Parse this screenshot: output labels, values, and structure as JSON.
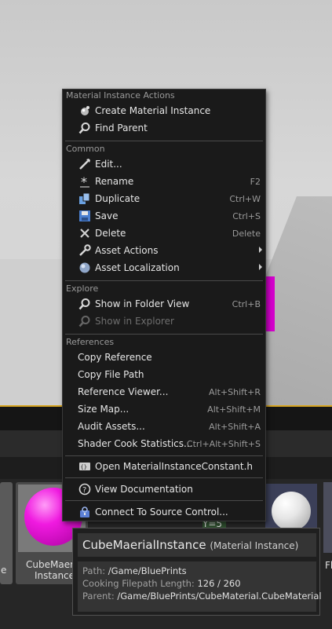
{
  "menu": {
    "sections": [
      {
        "header": "Material Instance Actions",
        "items": [
          {
            "label": "Create Material Instance",
            "icon": "material-instance-icon"
          },
          {
            "label": "Find Parent",
            "icon": "magnifier-icon"
          }
        ]
      },
      {
        "header": "Common",
        "items": [
          {
            "label": "Edit...",
            "icon": "pencil-icon",
            "shortcut": ""
          },
          {
            "label": "Rename",
            "icon": "rename-asterisk-icon",
            "shortcut": "F2"
          },
          {
            "label": "Duplicate",
            "icon": "duplicate-icon",
            "shortcut": "Ctrl+W"
          },
          {
            "label": "Save",
            "icon": "save-floppy-icon",
            "shortcut": "Ctrl+S"
          },
          {
            "label": "Delete",
            "icon": "delete-x-icon",
            "shortcut": "Delete"
          },
          {
            "label": "Asset Actions",
            "icon": "wrench-icon",
            "submenu": true
          },
          {
            "label": "Asset Localization",
            "icon": "globe-icon",
            "submenu": true
          }
        ]
      },
      {
        "header": "Explore",
        "items": [
          {
            "label": "Show in Folder View",
            "icon": "magnifier-icon",
            "shortcut": "Ctrl+B"
          },
          {
            "label": "Show in Explorer",
            "icon": "magnifier-icon",
            "disabled": true
          }
        ]
      },
      {
        "header": "References",
        "items": [
          {
            "label": "Copy Reference"
          },
          {
            "label": "Copy File Path"
          },
          {
            "label": "Reference Viewer...",
            "shortcut": "Alt+Shift+R"
          },
          {
            "label": "Size Map...",
            "shortcut": "Alt+Shift+M"
          },
          {
            "label": "Audit Assets...",
            "shortcut": "Alt+Shift+A"
          },
          {
            "label": "Shader Cook Statistics...",
            "shortcut": "Ctrl+Alt+Shift+S"
          }
        ]
      }
    ],
    "extra_items": [
      {
        "label": "Open MaterialInstanceConstant.h",
        "icon": "source-code-icon"
      },
      {
        "label": "View Documentation",
        "icon": "help-circle-icon"
      },
      {
        "label": "Connect To Source Control...",
        "icon": "source-control-icon"
      }
    ]
  },
  "content_browser": {
    "tile_label_line1": "CubeMaeri",
    "tile_label_line2": "Instance",
    "left_tile_fragment": "e",
    "right_tile_fragment": "Fl",
    "gray_tile_fragment": "Y=5"
  },
  "tooltip": {
    "asset_name": "CubeMaerialInstance",
    "asset_type": "(Material Instance)",
    "path_key": "Path:",
    "path_value": "/Game/BluePrints",
    "cook_key": "Cooking Filepath Length:",
    "cook_value": "126 / 260",
    "parent_key": "Parent:",
    "parent_value": "/Game/BluePrints/CubeMaterial.CubeMaterial"
  },
  "colors": {
    "menu_bg": "#1a1a1a",
    "accent_orange": "#d7a623",
    "magenta_material": "#f01ae0"
  }
}
